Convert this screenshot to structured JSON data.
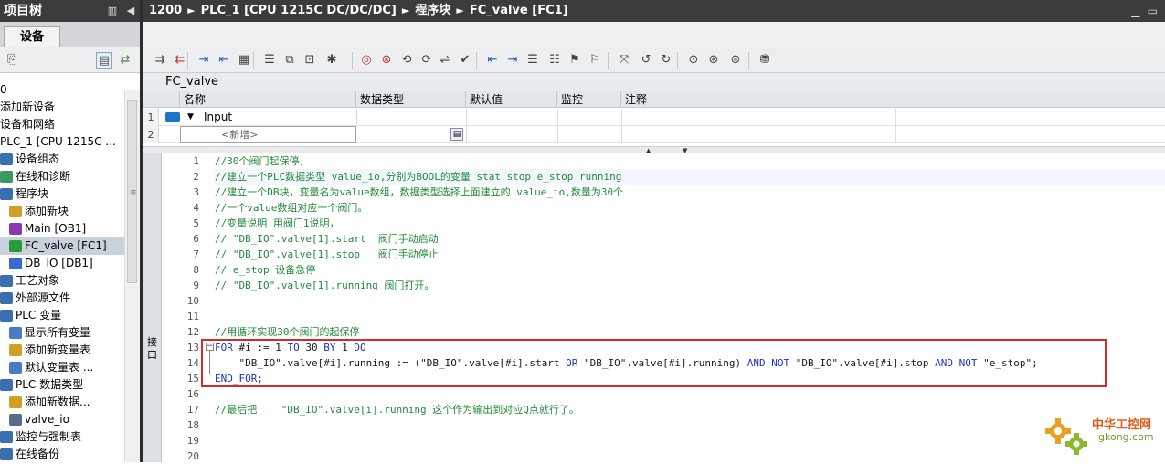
{
  "sidebar": {
    "title": "项目树",
    "device_tab": "设备",
    "tree": [
      {
        "label": "0",
        "icon": "none",
        "indent": 0
      },
      {
        "label": "添加新设备",
        "icon": "add-device-icon",
        "indent": 0
      },
      {
        "label": "设备和网络",
        "icon": "network-icon",
        "indent": 0
      },
      {
        "label": "PLC_1 [CPU 1215C ...",
        "icon": "plc-icon",
        "indent": 0
      },
      {
        "label": "设备组态",
        "icon": "device-config-icon",
        "indent": 1
      },
      {
        "label": "在线和诊断",
        "icon": "online-diag-icon",
        "indent": 1
      },
      {
        "label": "程序块",
        "icon": "folder-icon",
        "indent": 1
      },
      {
        "label": "添加新块",
        "icon": "add-block-icon",
        "indent": 2
      },
      {
        "label": "Main [OB1]",
        "icon": "ob-block-icon",
        "indent": 2
      },
      {
        "label": "FC_valve [FC1]",
        "icon": "fc-block-icon",
        "indent": 2,
        "selected": true
      },
      {
        "label": "DB_IO [DB1]",
        "icon": "db-block-icon",
        "indent": 2
      },
      {
        "label": "工艺对象",
        "icon": "folder-icon",
        "indent": 1
      },
      {
        "label": "外部源文件",
        "icon": "folder-icon",
        "indent": 1
      },
      {
        "label": "PLC 变量",
        "icon": "folder-icon",
        "indent": 1
      },
      {
        "label": "显示所有变量",
        "icon": "tag-table-icon",
        "indent": 2
      },
      {
        "label": "添加新变量表",
        "icon": "add-tag-table-icon",
        "indent": 2
      },
      {
        "label": "默认变量表 ...",
        "icon": "tag-table-icon",
        "indent": 2
      },
      {
        "label": "PLC 数据类型",
        "icon": "folder-icon",
        "indent": 1
      },
      {
        "label": "添加新数据...",
        "icon": "add-datatype-icon",
        "indent": 2
      },
      {
        "label": "valve_io",
        "icon": "datatype-icon",
        "indent": 2
      },
      {
        "label": "监控与强制表",
        "icon": "folder-icon",
        "indent": 1
      },
      {
        "label": "在线备份",
        "icon": "folder-icon",
        "indent": 1
      }
    ]
  },
  "breadcrumb": {
    "items": [
      "1200",
      "PLC_1 [CPU 1215C DC/DC/DC]",
      "程序块",
      "FC_valve [FC1]"
    ]
  },
  "editor": {
    "block_name": "FC_valve",
    "interface_headers": {
      "name": "名称",
      "datatype": "数据类型",
      "default": "默认值",
      "monitor": "监控",
      "comment": "注释"
    },
    "interface_rows": [
      {
        "num": "1",
        "name": "Input"
      },
      {
        "num": "2",
        "name": "<新增>"
      }
    ],
    "side_tab": "接口",
    "code_lines": [
      {
        "n": "1",
        "text": "//30个阀门起保停，",
        "type": "comment"
      },
      {
        "n": "2",
        "text": "//建立一个PLC数据类型 value_io,分别为BOOL的变量 stat stop e_stop running",
        "type": "comment"
      },
      {
        "n": "3",
        "text": "//建立一个DB块，变量名为value数组，数据类型选择上面建立的 value_io,数量为30个",
        "type": "comment"
      },
      {
        "n": "4",
        "text": "//一个value数组对应一个阀门。",
        "type": "comment"
      },
      {
        "n": "5",
        "text": "//变量说明 用阀门1说明，",
        "type": "comment"
      },
      {
        "n": "6",
        "text": "// \"DB_IO\".valve[1].start  阀门手动启动",
        "type": "comment"
      },
      {
        "n": "7",
        "text": "// \"DB_IO\".valve[1].stop   阀门手动停止",
        "type": "comment"
      },
      {
        "n": "8",
        "text": "// e_stop 设备急停",
        "type": "comment"
      },
      {
        "n": "9",
        "text": "// \"DB_IO\".valve[1].running 阀门打开。",
        "type": "comment"
      },
      {
        "n": "10",
        "text": "",
        "type": "plain"
      },
      {
        "n": "11",
        "text": "",
        "type": "plain"
      },
      {
        "n": "12",
        "text": "//用循环实现30个阀门的起保停",
        "type": "comment"
      },
      {
        "n": "13",
        "text": "FOR #i := 1 TO 30 BY 1 DO",
        "type": "for"
      },
      {
        "n": "14",
        "text": "    \"DB_IO\".valve[#i].running := (\"DB_IO\".valve[#i].start OR \"DB_IO\".valve[#i].running) AND NOT \"DB_IO\".valve[#i].stop AND NOT \"e_stop\";",
        "type": "code"
      },
      {
        "n": "15",
        "text": "END_FOR;",
        "type": "endfor"
      },
      {
        "n": "16",
        "text": "",
        "type": "plain"
      },
      {
        "n": "17",
        "text": "//最后把    \"DB_IO\".valve[i].running 这个作为输出到对应Q点就行了。",
        "type": "comment"
      },
      {
        "n": "18",
        "text": "",
        "type": "plain"
      },
      {
        "n": "19",
        "text": "",
        "type": "plain"
      },
      {
        "n": "20",
        "text": "",
        "type": "plain"
      }
    ]
  },
  "watermark": {
    "brand": "中华工控网",
    "url": "gkong.com"
  }
}
